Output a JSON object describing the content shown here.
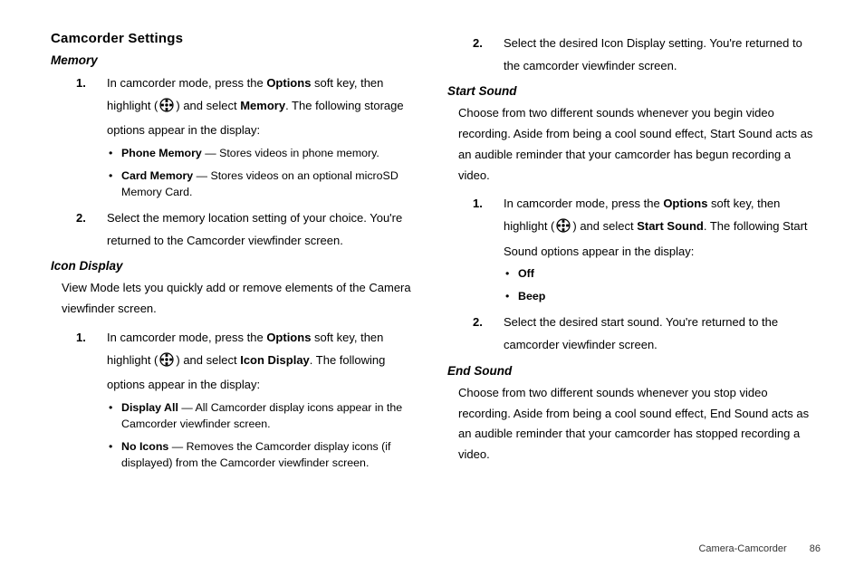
{
  "title": "Camcorder Settings",
  "icon_name": "settings-dpad-icon",
  "memory": {
    "heading": "Memory",
    "step1_pre": "In camcorder mode, press the ",
    "step1_bold1": "Options",
    "step1_mid": " soft key, then highlight (",
    "step1_post_icon": ") and select ",
    "step1_bold2": "Memory",
    "step1_tail": ". The following storage options appear in the display:",
    "opt_phone_b": "Phone Memory",
    "opt_phone_t": " — Stores videos in phone memory.",
    "opt_card_b": "Card Memory",
    "opt_card_t": " — Stores videos on an optional microSD Memory Card.",
    "step2": "Select the memory location setting of your choice. You're returned to the Camcorder viewfinder screen."
  },
  "icon_display": {
    "heading": "Icon Display",
    "intro": "View Mode lets you quickly add or remove elements of the Camera viewfinder screen.",
    "step1_pre": "In camcorder mode, press the ",
    "step1_bold1": "Options",
    "step1_mid": " soft key, then highlight (",
    "step1_post_icon": ") and select ",
    "step1_bold2": "Icon Display",
    "step1_tail": ". The following options appear in the display:",
    "opt_all_b": "Display All",
    "opt_all_t": " — All Camcorder display icons appear in the Camcorder viewfinder screen.",
    "opt_none_b": "No Icons",
    "opt_none_t": " — Removes the Camcorder display icons (if displayed) from the Camcorder viewfinder screen."
  },
  "right_step2": "Select the desired Icon Display setting. You're returned to the camcorder viewfinder screen.",
  "start_sound": {
    "heading": "Start Sound",
    "intro": "Choose from two different sounds whenever you begin video recording. Aside from being a cool sound effect, Start Sound acts as an audible reminder that your camcorder has begun recording a video.",
    "step1_pre": "In camcorder mode, press the ",
    "step1_bold1": "Options",
    "step1_mid": " soft key, then highlight (",
    "step1_post_icon": ") and select ",
    "step1_bold2": "Start Sound",
    "step1_tail": ". The following Start Sound options appear in the display:",
    "opt_off": "Off",
    "opt_beep": "Beep",
    "step2": "Select the desired start sound. You're returned to the camcorder viewfinder screen."
  },
  "end_sound": {
    "heading": "End Sound",
    "intro": "Choose from two different sounds whenever you stop video recording. Aside from being a cool sound effect, End Sound acts as an audible reminder that your camcorder has stopped recording a video."
  },
  "footer": {
    "chapter": "Camera-Camcorder",
    "page": "86"
  }
}
